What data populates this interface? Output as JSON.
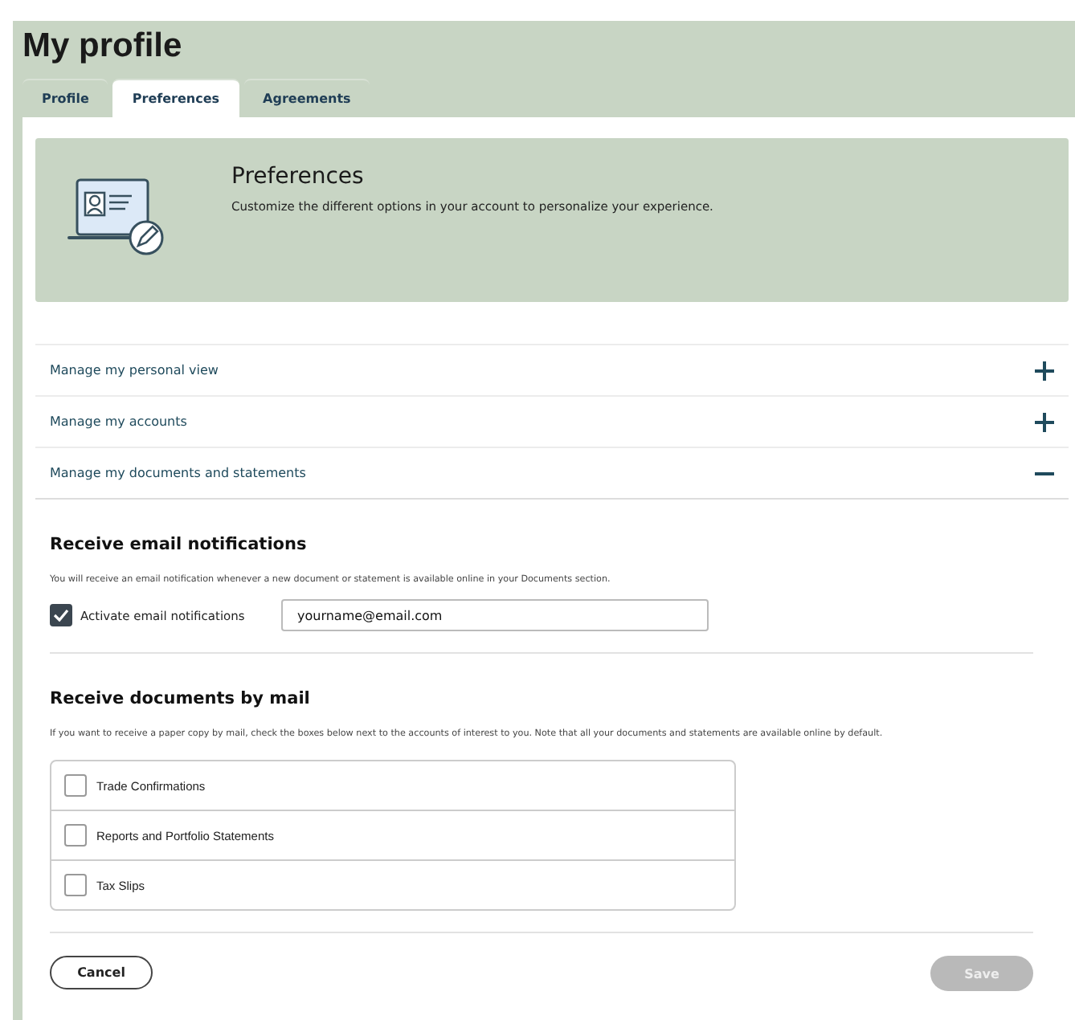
{
  "title": "My profile",
  "tabs": [
    {
      "label": "Profile",
      "selected": false
    },
    {
      "label": "Preferences",
      "selected": true
    },
    {
      "label": "Agreements",
      "selected": false
    }
  ],
  "banner": {
    "title": "Preferences",
    "text": "Customize the different options in your account to personalize your experience."
  },
  "accordion": [
    {
      "label": "Manage my personal view",
      "expanded": false
    },
    {
      "label": "Manage my accounts",
      "expanded": false
    },
    {
      "label": "Manage my documents and statements",
      "expanded": true
    }
  ],
  "email_section": {
    "heading": "Receive email notifications",
    "text": "You will receive an email notification whenever a new document or statement is available online in your Documents section.",
    "checkbox": {
      "label": "Activate email notifications",
      "checked": true
    },
    "email": "yourname@email.com"
  },
  "mail_section": {
    "heading": "Receive documents by mail",
    "text": "If you want to receive a paper copy by mail, check the boxes below next to the accounts of interest to you. Note that all your documents and statements are available online by default.",
    "options": [
      {
        "label": "Trade Confirmations",
        "checked": false
      },
      {
        "label": "Reports and Portfolio Statements",
        "checked": false
      },
      {
        "label": "Tax Slips",
        "checked": false
      }
    ]
  },
  "buttons": {
    "cancel": {
      "label": "Cancel",
      "disabled": false
    },
    "save": {
      "label": "Save",
      "disabled": true
    }
  }
}
